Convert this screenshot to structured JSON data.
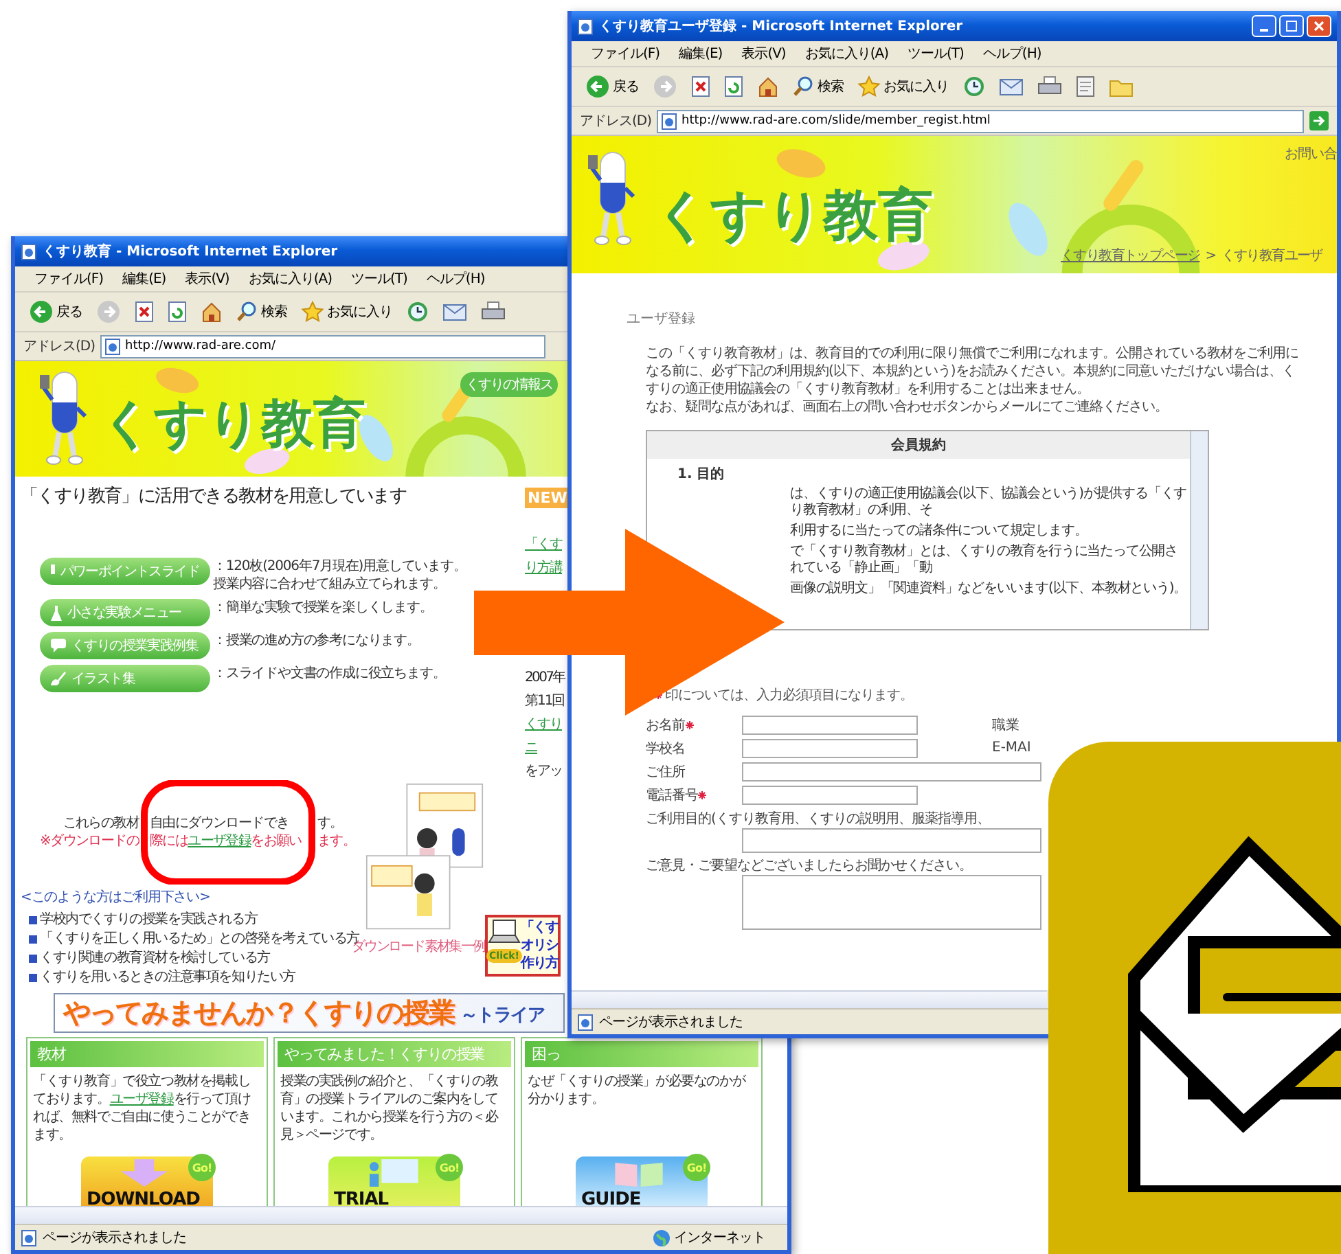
{
  "home_window": {
    "title": "くすり教育 - Microsoft Internet Explorer",
    "menu": [
      "ファイル(F)",
      "編集(E)",
      "表示(V)",
      "お気に入り(A)",
      "ツール(T)",
      "ヘルプ(H)"
    ],
    "toolbar": [
      {
        "kind": "back",
        "label": "戻る"
      },
      {
        "kind": "forward"
      },
      {
        "kind": "stop"
      },
      {
        "kind": "refresh"
      },
      {
        "kind": "home"
      },
      {
        "kind": "search",
        "label": "検索"
      },
      {
        "kind": "favorites",
        "label": "お気に入り"
      },
      {
        "kind": "history"
      },
      {
        "kind": "mail"
      },
      {
        "kind": "print"
      }
    ],
    "address_label": "アドレス(D)",
    "url": "http://www.rad-are.com/",
    "page": {
      "logo": "くすり教育",
      "site_tab": "くすりの情報ス",
      "heading": "「くすり教育」に活用できる教材を用意しています",
      "features": [
        {
          "kind": "slides",
          "label": "パワーポイントスライド",
          "description": [
            "：120枚(2006年7月現在)用意しています。",
            "授業内容に合わせて組み立てられます。"
          ]
        },
        {
          "kind": "experiment",
          "label": "小さな実験メニュー",
          "description": [
            "：簡単な実験で授業を楽しくします。"
          ]
        },
        {
          "kind": "casebook",
          "label": "くすりの授業実践例集",
          "description": [
            "：授業の進め方の参考になります。"
          ]
        },
        {
          "kind": "illustrations",
          "label": "イラスト集",
          "description": [
            "：スライドや文書の作成に役立ちます。"
          ]
        }
      ],
      "download_note": [
        "これらの教材",
        "自由にダウンロードでき",
        "す。"
      ],
      "register_note": [
        {
          "text": "※ダウンロードの"
        },
        {
          "text": "際には",
          "link": "ユーザ登録",
          "after": "をお願い"
        },
        {
          "text": "ます。"
        }
      ],
      "audience_heading": "<このような方はご利用下さい>",
      "audience": [
        "学校内でくすりの授業を実践される方",
        "「くすりを正しく用いるため」との啓発を考えている方",
        "くすり関連の教育資材を検討している方",
        "くすりを用いるときの注意事項を知りたい方"
      ],
      "sample_caption": "ダウンロード素材集一例",
      "promo": {
        "lines": [
          "「くす",
          "オリシ",
          "作り方"
        ],
        "button": "Click!"
      },
      "news": {
        "title": "NEW",
        "lines": [
          {
            "kind": "link",
            "text": "「くす"
          },
          {
            "kind": "link",
            "text": "り方講"
          },
          {
            "kind": "gap"
          },
          {
            "kind": "date",
            "text": "2007年"
          },
          {
            "kind": "text",
            "text": "第11回"
          },
          {
            "kind": "link",
            "text": "くすり"
          },
          {
            "kind": "link",
            "text": "ニ"
          },
          {
            "kind": "text",
            "text": "をアッ"
          }
        ]
      },
      "banner_title": "やってみませんか？くすりの授業",
      "banner_subtitle": "～トライア",
      "cards": [
        {
          "kind": "download",
          "title": "教材",
          "text": {
            "before": "「くすり教育」で役立つ教材を掲載しております。",
            "link": "ユーザ登録",
            "after": "を行って頂ければ、無料でご自由に使うことができます。"
          },
          "button": "DOWNLOAD",
          "badge": "Go!"
        },
        {
          "kind": "trial",
          "title": "やってみました！くすりの授業",
          "text": {
            "before": "授業の実践例の紹介と、「くすりの教育」の授業トライアルのご案内をしています。これから授業を行う方の＜必見＞ページです。"
          },
          "button": "TRIAL",
          "badge": "Go!"
        },
        {
          "kind": "guide",
          "title": "困っ",
          "text": {
            "before": "なぜ「くすりの授業」が必要なのかが分かります。"
          },
          "button": "GUIDE",
          "badge": "Go!"
        }
      ]
    },
    "status": "ページが表示されました",
    "zone": "インターネット"
  },
  "register_window": {
    "title": "くすり教育ユーザ登録 - Microsoft Internet Explorer",
    "menu": [
      "ファイル(F)",
      "編集(E)",
      "表示(V)",
      "お気に入り(A)",
      "ツール(T)",
      "ヘルプ(H)"
    ],
    "toolbar": [
      {
        "kind": "back",
        "label": "戻る"
      },
      {
        "kind": "forward"
      },
      {
        "kind": "stop"
      },
      {
        "kind": "refresh"
      },
      {
        "kind": "home"
      },
      {
        "kind": "search",
        "label": "検索"
      },
      {
        "kind": "favorites",
        "label": "お気に入り"
      },
      {
        "kind": "history"
      },
      {
        "kind": "mail"
      },
      {
        "kind": "print"
      },
      {
        "kind": "edit"
      },
      {
        "kind": "folder"
      }
    ],
    "address_label": "アドレス(D)",
    "url": "http://www.rad-are.com/slide/member_regist.html",
    "page": {
      "logo": "くすり教育",
      "contact": "お問い合",
      "breadcrumb": {
        "link": "くすり教育トップページ",
        "separator": ">",
        "current": "くすり教育ユーザ"
      },
      "heading": "ユーザ登録",
      "intro": [
        "この「くすり教育教材」は、教育目的での利用に限り無償でご利用になれます。公開されている教材をご利用になる前に、必ず下記の利用規約(以下、本規約という)をお読みください。本規約に同意いただけない場合は、くすりの適正使用協議会の「くすり教育教材」を利用することは出来ません。",
        "なお、疑問な点があれば、画面右上の問い合わせボタンからメールにてご連絡ください。"
      ],
      "terms": {
        "title": "会員規約",
        "section": "1. 目的",
        "lines": [
          "は、くすりの適正使用協議会(以下、協議会という)が提供する「くすり教育教材」の利用、そ",
          "利用するに当たっての諸条件について規定します。",
          "で「くすり教育教材」とは、くすりの教育を行うに当たって公開されている「静止画」「動",
          "画像の説明文」「関連資料」などをいいます(以下、本教材という)。"
        ]
      },
      "required_note": "印については、入力必須項目になります。",
      "fields": [
        {
          "kind": "short",
          "label": "お名前",
          "required": true,
          "side_label": "職業"
        },
        {
          "kind": "short",
          "label": "学校名",
          "required": false,
          "side_label": "E-MAI"
        },
        {
          "kind": "wide",
          "label": "ご住所",
          "required": false
        },
        {
          "kind": "short",
          "label": "電話番号",
          "required": true
        }
      ],
      "purpose_label": "ご利用目的(くすり教育用、くすりの説明用、服薬指導用、",
      "comments_label": "ご意見・ご要望などございましたらお聞かせください。"
    },
    "status": "ページが表示されました"
  }
}
